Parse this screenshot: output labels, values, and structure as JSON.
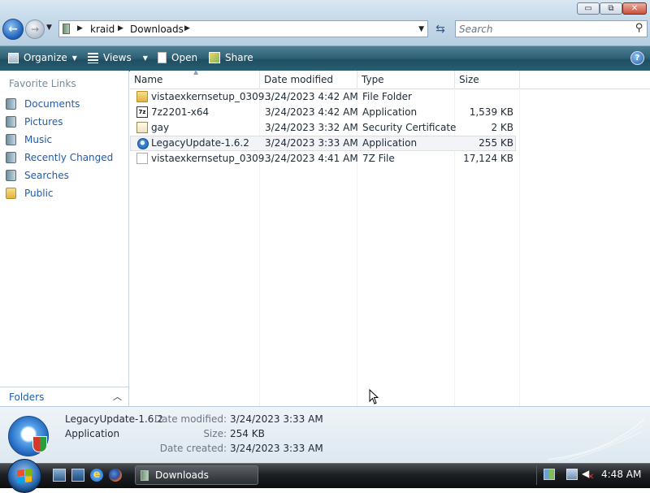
{
  "window": {
    "min_label": "▭",
    "max_label": "⧉",
    "close_label": "✕"
  },
  "address": {
    "separator": "▶",
    "crumbs": [
      "kraid",
      "Downloads"
    ],
    "dropdown": "▼"
  },
  "search": {
    "placeholder": "Search"
  },
  "toolbar": {
    "organize": "Organize",
    "views": "Views",
    "open": "Open",
    "share": "Share",
    "help": "?"
  },
  "nav": {
    "heading": "Favorite Links",
    "items": [
      {
        "label": "Documents",
        "icon": "documents-icon"
      },
      {
        "label": "Pictures",
        "icon": "pictures-icon"
      },
      {
        "label": "Music",
        "icon": "music-icon"
      },
      {
        "label": "Recently Changed",
        "icon": "recently-changed-icon"
      },
      {
        "label": "Searches",
        "icon": "searches-icon"
      },
      {
        "label": "Public",
        "icon": "public-folder-icon"
      }
    ],
    "folders_label": "Folders"
  },
  "columns": [
    "Name",
    "Date modified",
    "Type",
    "Size"
  ],
  "files": [
    {
      "name": "vistaexkernsetup_0309...",
      "date": "3/24/2023 4:42 AM",
      "type": "File Folder",
      "size": "",
      "icon": "folder-icon"
    },
    {
      "name": "7z2201-x64",
      "date": "3/24/2023 4:42 AM",
      "type": "Application",
      "size": "1,539 KB",
      "icon": "7zip-icon"
    },
    {
      "name": "gay",
      "date": "3/24/2023 3:32 AM",
      "type": "Security Certificate",
      "size": "2 KB",
      "icon": "certificate-icon"
    },
    {
      "name": "LegacyUpdate-1.6.2",
      "date": "3/24/2023 3:33 AM",
      "type": "Application",
      "size": "255 KB",
      "icon": "legacy-update-icon"
    },
    {
      "name": "vistaexkernsetup_0309...",
      "date": "3/24/2023 4:41 AM",
      "type": "7Z File",
      "size": "17,124 KB",
      "icon": "file-icon"
    }
  ],
  "details": {
    "name": "LegacyUpdate-1.6.2",
    "type": "Application",
    "date_modified_label": "Date modified:",
    "date_modified": "3/24/2023 3:33 AM",
    "size_label": "Size:",
    "size": "254 KB",
    "date_created_label": "Date created:",
    "date_created": "3/24/2023 3:33 AM"
  },
  "taskbar": {
    "window_label": "Downloads",
    "clock": "4:48 AM",
    "ie_glyph": "e"
  }
}
